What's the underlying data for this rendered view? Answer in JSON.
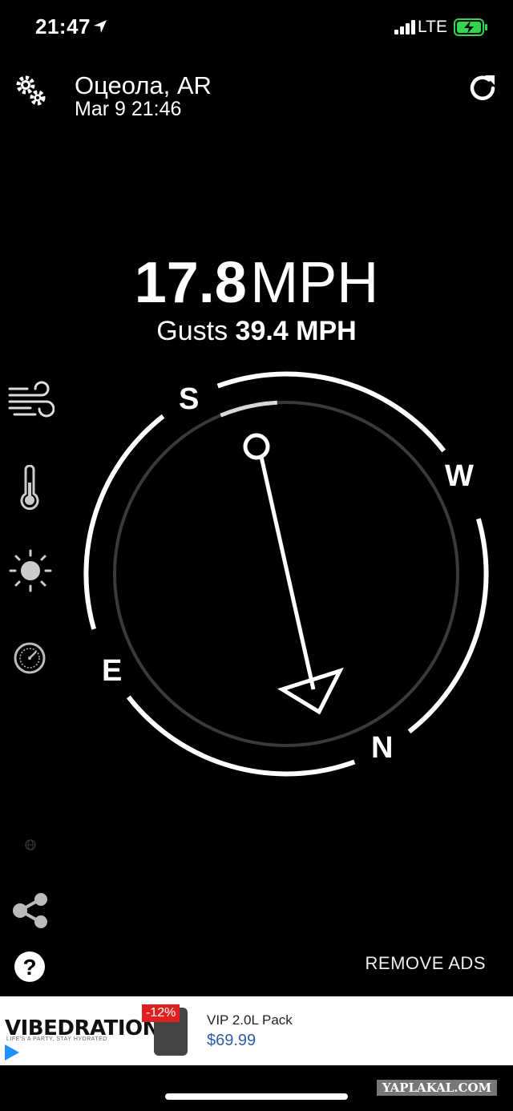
{
  "status_bar": {
    "time": "21:47",
    "network": "LTE",
    "location_icon": "location-arrow-icon",
    "signal_icon": "signal-bars-icon",
    "battery_icon": "battery-charging-icon",
    "battery_color": "#32d74b"
  },
  "header": {
    "location": "Оцеола, AR",
    "timestamp": "Mar 9 21:46",
    "settings_icon": "gears-icon",
    "refresh_icon": "refresh-icon"
  },
  "wind": {
    "speed": "17.8",
    "unit": "MPH",
    "gusts_label": "Gusts",
    "gusts_value": "39.4 MPH",
    "direction_deg": 165
  },
  "compass": {
    "s": "S",
    "w": "W",
    "e": "E",
    "n": "N"
  },
  "sidebar": {
    "items": [
      {
        "icon": "wind-icon"
      },
      {
        "icon": "thermometer-icon"
      },
      {
        "icon": "sun-icon"
      },
      {
        "icon": "pressure-gauge-icon"
      }
    ]
  },
  "bottom": {
    "share_icon": "share-icon",
    "help_icon": "help-icon",
    "remove_ads": "REMOVE ADS"
  },
  "ad": {
    "brand": "VIBEDRATION",
    "tagline": "LIFE'S A PARTY, STAY HYDRATED",
    "discount": "-12%",
    "product": "VIP 2.0L Pack",
    "price": "$69.99"
  },
  "watermark": "YAPLAKAL.COM"
}
